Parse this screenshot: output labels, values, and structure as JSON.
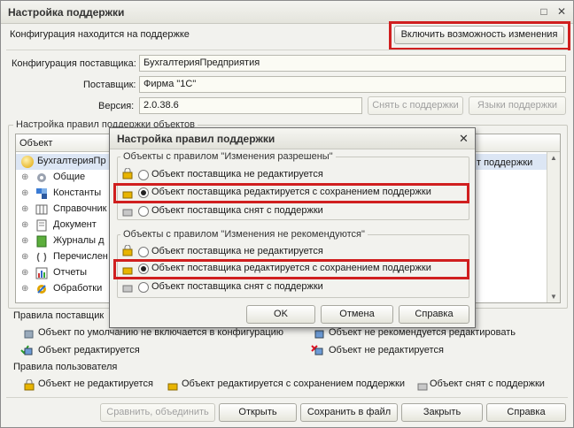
{
  "window": {
    "title": "Настройка поддержки",
    "btn_max": "□",
    "btn_close": "✕"
  },
  "top": {
    "status": "Конфигурация находится на поддержке",
    "enable_button": "Включить возможность изменения"
  },
  "vendor_config": {
    "label": "Конфигурация поставщика:",
    "value": "БухгалтерияПредприятия"
  },
  "vendor": {
    "label": "Поставщик:",
    "value": "Фирма \"1С\""
  },
  "version": {
    "label": "Версия:",
    "value": "2.0.38.6",
    "remove_support_button": "Снять с поддержки",
    "languages_button": "Языки поддержки"
  },
  "rules_group": {
    "title": "Настройка правил поддержки объектов",
    "column_object": "Объект",
    "items": [
      {
        "label": "БухгалтерияПр",
        "icon": "config-icon"
      },
      {
        "label": "Общие",
        "icon": "common-icon"
      },
      {
        "label": "Константы",
        "icon": "constants-icon"
      },
      {
        "label": "Справочник",
        "icon": "catalog-icon"
      },
      {
        "label": "Документ",
        "icon": "document-icon"
      },
      {
        "label": "Журналы д",
        "icon": "journal-icon"
      },
      {
        "label": "Перечислен",
        "icon": "enum-icon"
      },
      {
        "label": "Отчеты",
        "icon": "report-icon"
      },
      {
        "label": "Обработки",
        "icon": "processing-icon"
      }
    ],
    "right_col_text": "т поддержки"
  },
  "vendor_rules": {
    "title": "Правила поставщик",
    "items": [
      "Объект по умолчанию не включается в конфигурацию",
      "Объект не рекомендуется редактировать",
      "Объект редактируется",
      "Объект не редактируется"
    ]
  },
  "user_rules": {
    "title": "Правила пользователя",
    "items": [
      "Объект не редактируется",
      "Объект редактируется с сохранением поддержки",
      "Объект снят с поддержки"
    ]
  },
  "bottom_buttons": {
    "compare": "Сравнить, объединить",
    "open": "Открыть",
    "save_file": "Сохранить в файл",
    "close": "Закрыть",
    "help": "Справка"
  },
  "dialog": {
    "title": "Настройка правил поддержки",
    "close": "✕",
    "group1": {
      "title": "Объекты с правилом \"Изменения разрешены\"",
      "options": [
        "Объект поставщика не редактируется",
        "Объект поставщика редактируется с сохранением поддержки",
        "Объект поставщика снят с поддержки"
      ],
      "selected": 1
    },
    "group2": {
      "title": "Объекты с правилом \"Изменения не рекомендуются\"",
      "options": [
        "Объект поставщика не редактируется",
        "Объект поставщика редактируется с сохранением поддержки",
        "Объект поставщика снят с поддержки"
      ],
      "selected": 1
    },
    "ok": "OK",
    "cancel": "Отмена",
    "help": "Справка"
  },
  "colors": {
    "highlight": "#d01f1f",
    "lock_gold": "#e8b400"
  }
}
